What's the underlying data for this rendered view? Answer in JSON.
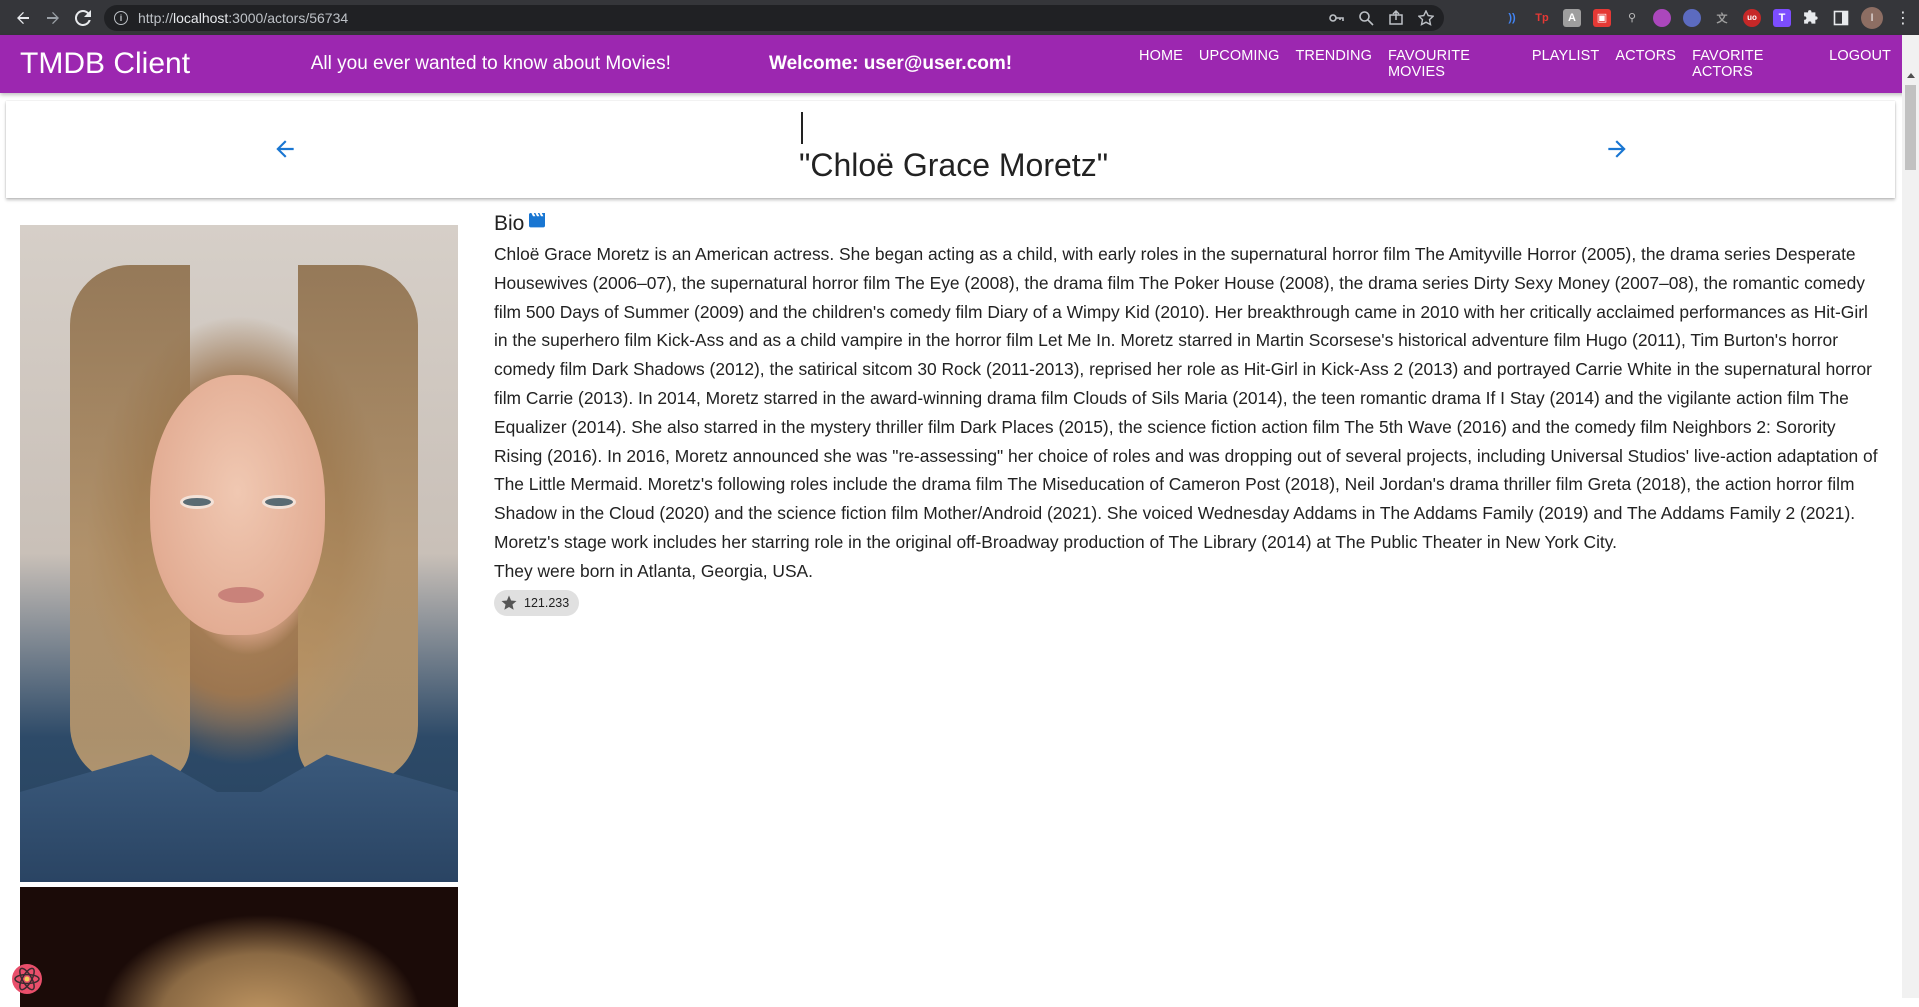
{
  "browser": {
    "url_prefix": "http://",
    "url_host": "localhost",
    "url_path": ":3000/actors/56734",
    "profile_initial": "I"
  },
  "appbar": {
    "brand": "TMDB Client",
    "tagline": "All you ever wanted to know about Movies!",
    "welcome": "Welcome: user@user.com!",
    "menu": [
      "HOME",
      "UPCOMING",
      "TRENDING",
      "FAVOURITE MOVIES",
      "PLAYLIST",
      "ACTORS",
      "FAVORITE ACTORS",
      "LOGOUT"
    ],
    "color": "#9c27b0"
  },
  "header": {
    "title": "\"Chloë Grace Moretz\""
  },
  "bio": {
    "heading": "Bio",
    "text": "Chloë Grace Moretz is an American actress. She began acting as a child, with early roles in the supernatural horror film The Amityville Horror (2005), the drama series Desperate Housewives (2006–07), the supernatural horror film The Eye (2008), the drama film The Poker House (2008), the drama series Dirty Sexy Money (2007–08), the romantic comedy film 500 Days of Summer (2009) and the children's comedy film Diary of a Wimpy Kid (2010). Her breakthrough came in 2010 with her critically acclaimed performances as Hit-Girl in the superhero film Kick-Ass and as a child vampire in the horror film Let Me In. Moretz starred in Martin Scorsese's historical adventure film Hugo (2011), Tim Burton's horror comedy film Dark Shadows (2012), the satirical sitcom 30 Rock (2011-2013), reprised her role as Hit-Girl in Kick-Ass 2 (2013) and portrayed Carrie White in the supernatural horror film Carrie (2013). In 2014, Moretz starred in the award-winning drama film Clouds of Sils Maria (2014), the teen romantic drama If I Stay (2014) and the vigilante action film The Equalizer (2014). She also starred in the mystery thriller film Dark Places (2015), the science fiction action film The 5th Wave (2016) and the comedy film Neighbors 2: Sorority Rising (2016). In 2016, Moretz announced she was \"re-assessing\" her choice of roles and was dropping out of several projects, including Universal Studios' live-action adaptation of The Little Mermaid. Moretz's following roles include the drama film The Miseducation of Cameron Post (2018), Neil Jordan's drama thriller film Greta (2018), the action horror film Shadow in the Cloud (2020) and the science fiction film Mother/Android (2021). She voiced Wednesday Addams in The Addams Family (2019) and The Addams Family 2 (2021). Moretz's stage work includes her starring role in the original off-Broadway production of The Library (2014) at The Public Theater in New York City.",
    "born": "They were born in Atlanta, Georgia, USA.",
    "popularity": "121.233"
  },
  "icons": {
    "back": "arrow-back-icon",
    "forward": "arrow-forward-icon",
    "bio": "movie-clapper-icon",
    "popularity": "star-rate-icon"
  }
}
